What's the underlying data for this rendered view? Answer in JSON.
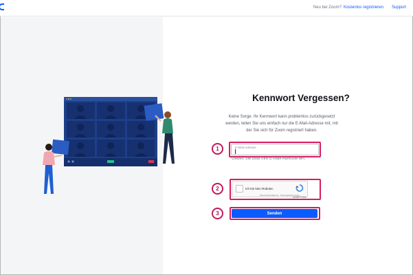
{
  "header": {
    "question": "Neu bei Zoom?",
    "register_link": "Kostenlos registrieren",
    "support_link": "Support"
  },
  "main": {
    "title": "Kennwort Vergessen?",
    "description": "Keine Sorge. Ihr Kennwort kann problemlos zurückgesetzt werden, teilen Sie uns einfach nur die E-Mail-Adresse mit, mit der Sie sich für Zoom registriert haben.",
    "email_placeholder": "E-Mail-Adresse",
    "email_value": "",
    "email_hint": "Geben Sie bitte Ihre E-Mail-Adresse ein.",
    "captcha_label": "Ich bin kein Roboter.",
    "captcha_brand": "reCAPTCHA",
    "captcha_footer": "Datenschutzerklärung - Nutzungsbedingungen",
    "send_button": "Senden"
  },
  "annotations": [
    "1",
    "2",
    "3"
  ],
  "colors": {
    "accent": "#0b5cff",
    "highlight": "#d81b60",
    "left_panel_bg": "#f4f5f6",
    "screen_dark": "#1b3a7a"
  },
  "icons": {
    "logo": "zoom-logo-fragment",
    "recaptcha": "recaptcha-icon"
  }
}
